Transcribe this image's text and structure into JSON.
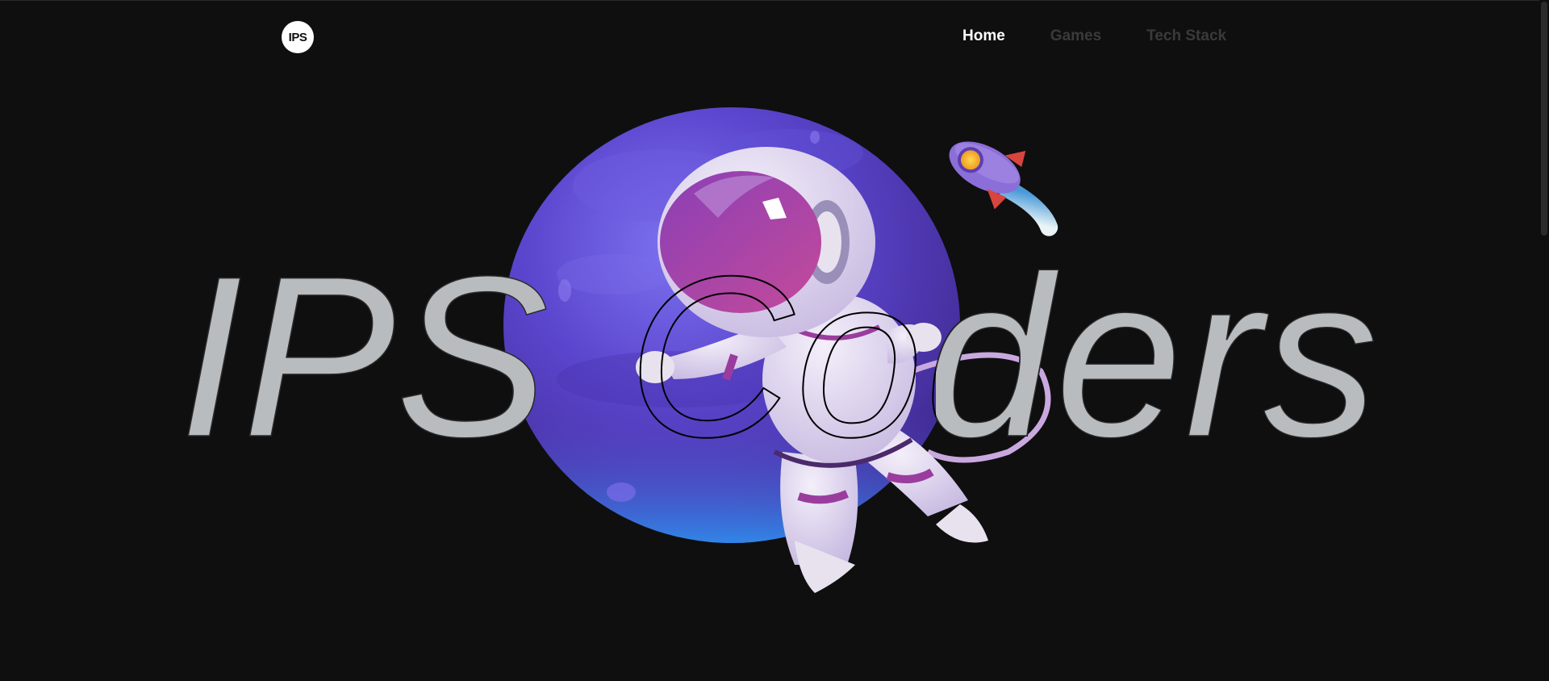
{
  "header": {
    "logo_text": "IPS",
    "nav": [
      {
        "label": "Home",
        "active": true
      },
      {
        "label": "Games",
        "active": false
      },
      {
        "label": "Tech Stack",
        "active": false
      }
    ]
  },
  "hero": {
    "title_part1": "IPS",
    "title_part2": "Coders",
    "illustration": "astronaut-planet-illustration",
    "rocket": "rocket-icon"
  },
  "colors": {
    "background": "#0f0f10",
    "title_fill": "#b8bcbf",
    "planet": "#5b44c8",
    "nav_active": "#ffffff",
    "nav_inactive": "#3a3a3a"
  }
}
